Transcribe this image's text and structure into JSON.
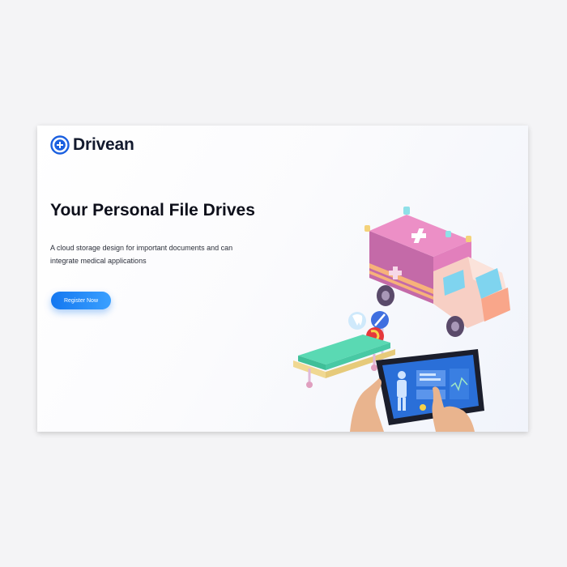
{
  "brand": {
    "name": "Drivean",
    "accent": "#1a5fe0"
  },
  "hero": {
    "title": "Your Personal File Drives",
    "description": "A cloud storage design for important documents and can integrate medical applications",
    "cta_label": "Register Now"
  },
  "illustration": {
    "icons": [
      "ambulance-icon",
      "stretcher-icon",
      "tablet-icon",
      "tooth-icon",
      "syringe-icon",
      "stomach-icon",
      "hand-icon"
    ]
  },
  "colors": {
    "page_bg": "#f4f4f6",
    "card_bg": "#ffffff",
    "button_start": "#1477f0",
    "button_end": "#3aa0ff",
    "ambulance_top": "#ec8fc6",
    "ambulance_side": "#c46aa8",
    "cab": "#f7cfc4",
    "stretcher": "#5ad9b3",
    "tablet_screen": "#2a6fd8"
  }
}
